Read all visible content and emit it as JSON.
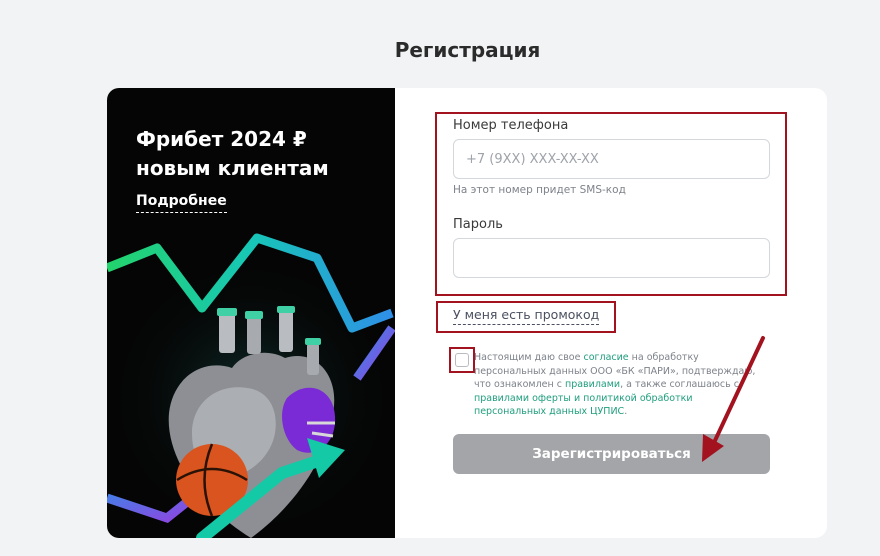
{
  "page": {
    "title": "Регистрация"
  },
  "promo": {
    "title": "Фрибет 2024 ₽ новым клиентам",
    "more_link": "Подробнее"
  },
  "form": {
    "phone": {
      "label": "Номер телефона",
      "placeholder": "+7 (9XX) XXX-XX-XX",
      "value": "",
      "hint": "На этот номер придет SMS-код"
    },
    "password": {
      "label": "Пароль",
      "placeholder": "",
      "value": ""
    },
    "promo_code_link": "У меня есть промокод",
    "consent": {
      "checked": false,
      "text_1": "Настоящим даю свое ",
      "link_1": "согласие",
      "text_2": " на обработку персональных данных ООО «БК «ПАРИ», подтверждаю, что ознакомлен с ",
      "link_2": "правилами",
      "text_3": ", а также соглашаюсь с ",
      "link_3": "правилами оферты и политикой обработки персональных данных ЦУПИС",
      "text_4": "."
    },
    "register_button": "Зарегистрироваться"
  },
  "colors": {
    "highlight": "#a3121f",
    "link": "#1f9e7d",
    "button_disabled": "#a3a5a8"
  }
}
